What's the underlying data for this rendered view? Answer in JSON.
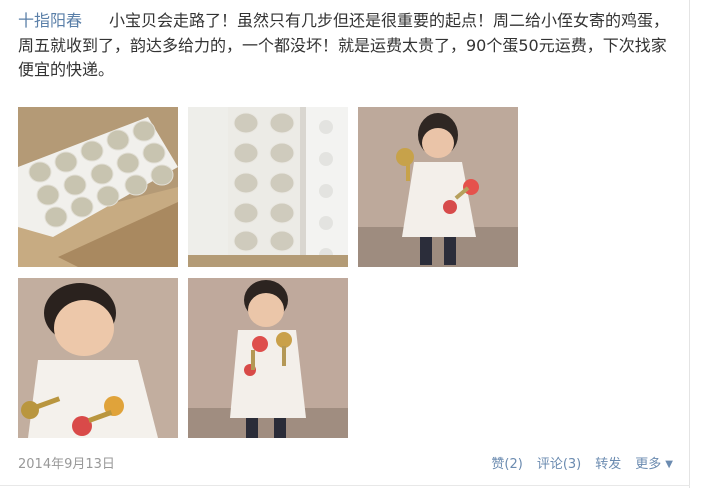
{
  "post": {
    "author": "十指阳春",
    "text": "小宝贝会走路了！虽然只有几步但还是很重要的起点！周二给小侄女寄的鸡蛋，周五就收到了，韵达多给力的，一个都没坏！就是运费太贵了，90个蛋50元运费，下次找家便宜的快递。",
    "date": "2014年9月13日",
    "actions": {
      "like": "赞(2)",
      "comment": "评论(3)",
      "forward": "转发",
      "more": "更多"
    },
    "icons": {
      "more": "chevron-down-icon"
    },
    "colors": {
      "author": "#5a7fa8",
      "action": "#6b8bb0",
      "date": "#999999"
    }
  }
}
